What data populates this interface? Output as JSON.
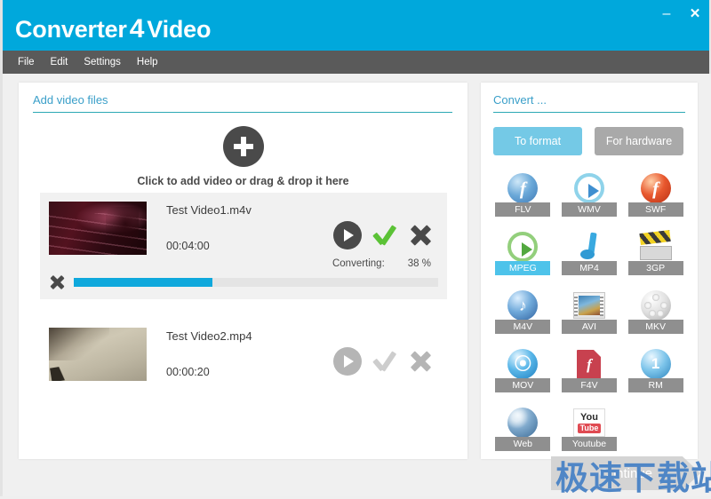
{
  "window": {
    "title_part1": "Converter",
    "title_num": "4",
    "title_part2": "Video",
    "minimize_label": "–",
    "close_label": "✕",
    "header_color": "#00a8dc",
    "accent_color": "#0fa8dc"
  },
  "menubar": {
    "items": [
      {
        "label": "File"
      },
      {
        "label": "Edit"
      },
      {
        "label": "Settings"
      },
      {
        "label": "Help"
      }
    ]
  },
  "left_panel": {
    "section_title": "Add video files",
    "dropzone_hint": "Click to add video or drag & drop it here",
    "files": [
      {
        "name": "Test Video1.m4v",
        "duration": "00:04:00",
        "status_label": "Converting:",
        "percent_label": "38 %",
        "percent_value": 38,
        "active": true
      },
      {
        "name": "Test Video2.mp4",
        "duration": "00:00:20",
        "active": false
      }
    ]
  },
  "right_panel": {
    "section_title": "Convert ...",
    "tabs": [
      {
        "label": "To format",
        "active": true
      },
      {
        "label": "For hardware",
        "active": false
      }
    ],
    "formats": [
      {
        "label": "FLV",
        "selected": false
      },
      {
        "label": "WMV",
        "selected": false
      },
      {
        "label": "SWF",
        "selected": false
      },
      {
        "label": "MPEG",
        "selected": true
      },
      {
        "label": "MP4",
        "selected": false
      },
      {
        "label": "3GP",
        "selected": false
      },
      {
        "label": "M4V",
        "selected": false
      },
      {
        "label": "AVI",
        "selected": false
      },
      {
        "label": "MKV",
        "selected": false
      },
      {
        "label": "MOV",
        "selected": false
      },
      {
        "label": "F4V",
        "selected": false
      },
      {
        "label": "RM",
        "selected": false
      },
      {
        "label": "Web",
        "selected": false
      },
      {
        "label": "Youtube",
        "selected": false
      }
    ]
  },
  "footer": {
    "continue_label": "Continue",
    "watermark": "极速下载站"
  },
  "icons": {
    "youtube_you": "You",
    "youtube_tube": "Tube",
    "rm_number": "1",
    "flash_glyph": "f"
  }
}
